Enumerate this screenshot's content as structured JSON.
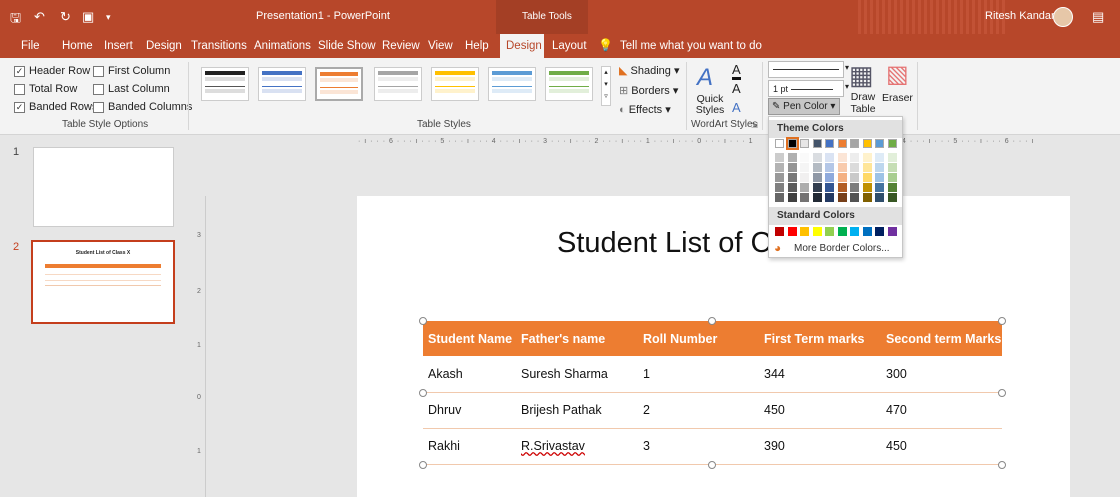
{
  "title_bar": {
    "doc_title": "Presentation1  -  PowerPoint",
    "context_tab": "Table Tools",
    "user": "Ritesh Kandari"
  },
  "tabs": [
    "File",
    "Home",
    "Insert",
    "Design",
    "Transitions",
    "Animations",
    "Slide Show",
    "Review",
    "View",
    "Help",
    "Design",
    "Layout"
  ],
  "tell_me": "Tell me what you want to do",
  "ribbon": {
    "options": {
      "header_row": "Header Row",
      "first_column": "First Column",
      "total_row": "Total Row",
      "last_column": "Last Column",
      "banded_rows": "Banded Rows",
      "banded_columns": "Banded Columns",
      "group": "Table Style Options"
    },
    "styles_group": "Table Styles",
    "shading": "Shading",
    "borders": "Borders",
    "effects": "Effects",
    "quick_styles": "Quick Styles",
    "wordart_group": "WordArt Styles",
    "pen_weight": "1 pt",
    "pen_color": "Pen Color",
    "draw_table": "Draw Table",
    "eraser": "Eraser",
    "colors": {
      "accent": "#b7472a",
      "table_header": "#ed7d31"
    }
  },
  "ruler_top": "· ı · · · 6 · · · ı · · · 5 · · · ı · · · 4 · · · ı · · · 3 · · · ı · · · 2 · · · ı · · · 1 · · · ı · · · 0 · · · ı · · · 1",
  "ruler_top_right": "4 · · · ı · · · 5 · · · ı · · · 6 · · · ı",
  "ruler_left_marks": [
    "3",
    "2",
    "1",
    "0",
    "1"
  ],
  "thumbnails": [
    {
      "number": "1"
    },
    {
      "number": "2",
      "title": "Student List of Class X"
    }
  ],
  "slide": {
    "title": "Student List of C",
    "table": {
      "headers": [
        "Student Name",
        "Father's name",
        "Roll Number",
        "First Term marks",
        "Second term Marks"
      ],
      "rows": [
        [
          "Akash",
          "Suresh Sharma",
          "1",
          "344",
          "300"
        ],
        [
          "Dhruv",
          "Brijesh Pathak",
          "2",
          "450",
          "470"
        ],
        [
          "Rakhi",
          "R.Srivastav",
          "3",
          "390",
          "450"
        ]
      ]
    }
  },
  "dropdown": {
    "theme_label": "Theme Colors",
    "standard_label": "Standard Colors",
    "more": "More Border Colors...",
    "theme_top": [
      "#ffffff",
      "#000000",
      "#e7e6e6",
      "#44546a",
      "#4472c4",
      "#ed7d31",
      "#a5a5a5",
      "#ffc000",
      "#5b9bd5",
      "#70ad47"
    ],
    "standard": [
      "#c00000",
      "#ff0000",
      "#ffc000",
      "#ffff00",
      "#92d050",
      "#00b050",
      "#00b0f0",
      "#0070c0",
      "#002060",
      "#7030a0"
    ]
  }
}
